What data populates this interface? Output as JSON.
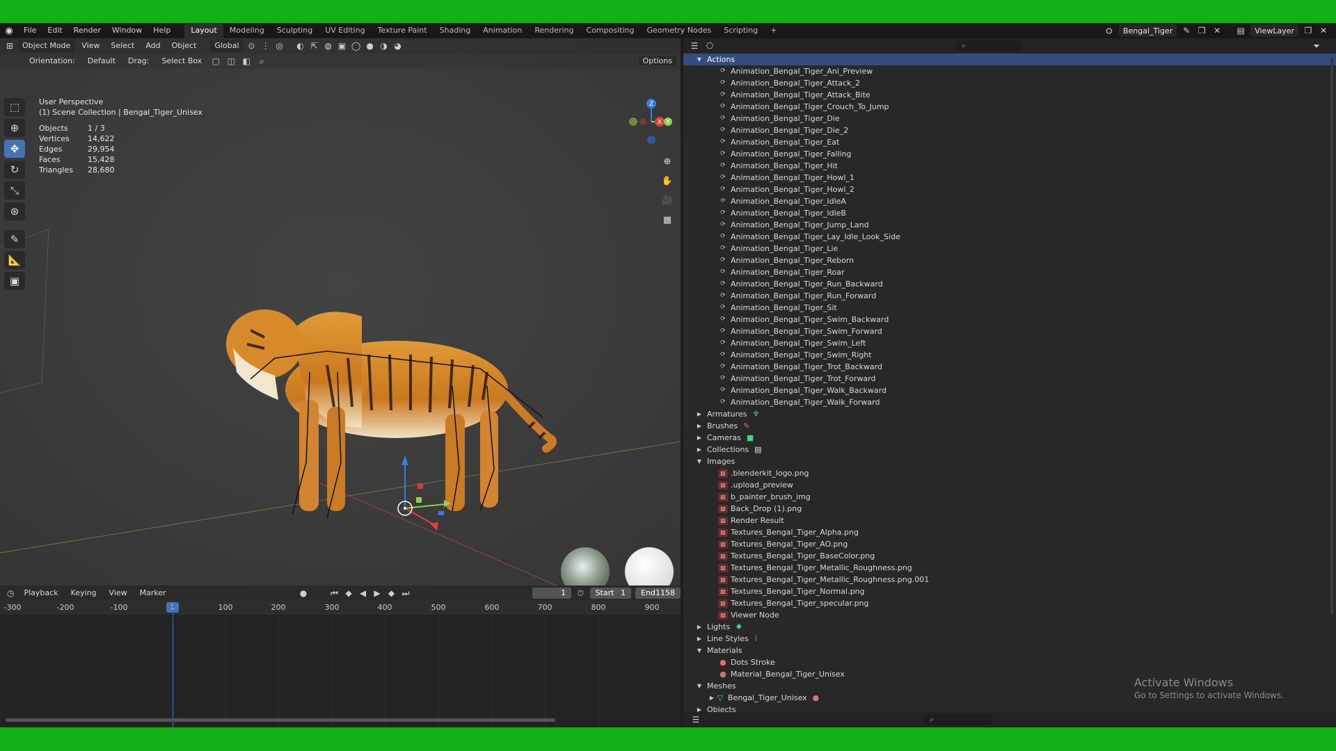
{
  "menu": [
    "File",
    "Edit",
    "Render",
    "Window",
    "Help"
  ],
  "workspaces": [
    "Layout",
    "Modeling",
    "Sculpting",
    "UV Editing",
    "Texture Paint",
    "Shading",
    "Animation",
    "Rendering",
    "Compositing",
    "Geometry Nodes",
    "Scripting"
  ],
  "active_workspace": "Layout",
  "add_workspace_label": "+",
  "scene_name": "Bengal_Tiger",
  "view_layer": "ViewLayer",
  "viewport": {
    "mode": "Object Mode",
    "menus": [
      "View",
      "Select",
      "Add",
      "Object"
    ],
    "orientation_global": "Global",
    "orientation_label": "Orientation:",
    "orientation_value": "Default",
    "drag_label": "Drag:",
    "drag_value": "Select Box",
    "options_label": "Options",
    "perspective": "User Perspective",
    "collection_path": "(1) Scene Collection | Bengal_Tiger_Unisex",
    "stats": [
      {
        "label": "Objects",
        "value": "1 / 3"
      },
      {
        "label": "Vertices",
        "value": "14,622"
      },
      {
        "label": "Edges",
        "value": "29,954"
      },
      {
        "label": "Faces",
        "value": "15,428"
      },
      {
        "label": "Triangles",
        "value": "28,680"
      }
    ],
    "gizmo_axes": [
      "Z",
      "X",
      "Y"
    ]
  },
  "timeline": {
    "menus": [
      "Playback",
      "Keying",
      "View",
      "Marker"
    ],
    "current_frame": "1",
    "start_label": "Start",
    "start_value": "1",
    "end_label": "End",
    "end_value": "1158",
    "ticks": [
      "-300",
      "-200",
      "-100",
      "100",
      "200",
      "300",
      "400",
      "500",
      "600",
      "700",
      "800",
      "900"
    ],
    "cursor_label": "1"
  },
  "outliner": {
    "rows": [
      {
        "type": "group",
        "label": "Actions",
        "expanded": true,
        "selected": true
      },
      {
        "type": "action",
        "label": "Animation_Bengal_Tiger_Ani_Preview"
      },
      {
        "type": "action",
        "label": "Animation_Bengal_Tiger_Attack_2"
      },
      {
        "type": "action",
        "label": "Animation_Bengal_Tiger_Attack_Bite"
      },
      {
        "type": "action",
        "label": "Animation_Bengal_Tiger_Crouch_To_Jump"
      },
      {
        "type": "action",
        "label": "Animation_Bengal_Tiger_Die"
      },
      {
        "type": "action",
        "label": "Animation_Bengal_Tiger_Die_2"
      },
      {
        "type": "action",
        "label": "Animation_Bengal_Tiger_Eat"
      },
      {
        "type": "action",
        "label": "Animation_Bengal_Tiger_Falling"
      },
      {
        "type": "action",
        "label": "Animation_Bengal_Tiger_Hit"
      },
      {
        "type": "action",
        "label": "Animation_Bengal_Tiger_Howl_1"
      },
      {
        "type": "action",
        "label": "Animation_Bengal_Tiger_Howl_2"
      },
      {
        "type": "action",
        "label": "Animation_Bengal_Tiger_IdleA"
      },
      {
        "type": "action",
        "label": "Animation_Bengal_Tiger_IdleB"
      },
      {
        "type": "action",
        "label": "Animation_Bengal_Tiger_Jump_Land"
      },
      {
        "type": "action",
        "label": "Animation_Bengal_Tiger_Lay_Idle_Look_Side"
      },
      {
        "type": "action",
        "label": "Animation_Bengal_Tiger_Lie"
      },
      {
        "type": "action",
        "label": "Animation_Bengal_Tiger_Reborn"
      },
      {
        "type": "action",
        "label": "Animation_Bengal_Tiger_Roar"
      },
      {
        "type": "action",
        "label": "Animation_Bengal_Tiger_Run_Backward"
      },
      {
        "type": "action",
        "label": "Animation_Bengal_Tiger_Run_Forward"
      },
      {
        "type": "action",
        "label": "Animation_Bengal_Tiger_Sit"
      },
      {
        "type": "action",
        "label": "Animation_Bengal_Tiger_Swim_Backward"
      },
      {
        "type": "action",
        "label": "Animation_Bengal_Tiger_Swim_Forward"
      },
      {
        "type": "action",
        "label": "Animation_Bengal_Tiger_Swim_Left"
      },
      {
        "type": "action",
        "label": "Animation_Bengal_Tiger_Swim_Right"
      },
      {
        "type": "action",
        "label": "Animation_Bengal_Tiger_Trot_Backward"
      },
      {
        "type": "action",
        "label": "Animation_Bengal_Tiger_Trot_Forward"
      },
      {
        "type": "action",
        "label": "Animation_Bengal_Tiger_Walk_Backward"
      },
      {
        "type": "action",
        "label": "Animation_Bengal_Tiger_Walk_Forward"
      },
      {
        "type": "group",
        "label": "Armatures",
        "expanded": false,
        "badge": "armature-icon",
        "badge_color": "#4fd08a"
      },
      {
        "type": "group",
        "label": "Brushes",
        "expanded": false,
        "badge": "brush-icon",
        "badge_color": "#e07070"
      },
      {
        "type": "group",
        "label": "Cameras",
        "expanded": false,
        "badge": "camera-icon",
        "badge_color": "#4fd08a"
      },
      {
        "type": "group",
        "label": "Collections",
        "expanded": false,
        "badge": "collection-icon",
        "badge_color": "#e8e8e8"
      },
      {
        "type": "group",
        "label": "Images",
        "expanded": true
      },
      {
        "type": "image",
        "label": ".blenderkit_logo.png"
      },
      {
        "type": "image",
        "label": ".upload_preview"
      },
      {
        "type": "image",
        "label": "b_painter_brush_img"
      },
      {
        "type": "image",
        "label": "Back_Drop (1).png"
      },
      {
        "type": "image",
        "label": "Render Result"
      },
      {
        "type": "image",
        "label": "Textures_Bengal_Tiger_Alpha.png"
      },
      {
        "type": "image",
        "label": "Textures_Bengal_Tiger_AO.png"
      },
      {
        "type": "image",
        "label": "Textures_Bengal_Tiger_BaseColor.png"
      },
      {
        "type": "image",
        "label": "Textures_Bengal_Tiger_Metallic_Roughness.png"
      },
      {
        "type": "image",
        "label": "Textures_Bengal_Tiger_Metallic_Roughness.png.001"
      },
      {
        "type": "image",
        "label": "Textures_Bengal_Tiger_Normal.png"
      },
      {
        "type": "image",
        "label": "Textures_Bengal_Tiger_specular.png"
      },
      {
        "type": "image",
        "label": "Viewer Node"
      },
      {
        "type": "group",
        "label": "Lights",
        "expanded": false,
        "badge": "light-icon",
        "badge_color": "#4fd08a"
      },
      {
        "type": "group",
        "label": "Line Styles",
        "expanded": false,
        "badge": "linestyle-icon",
        "badge_color": "#e07070"
      },
      {
        "type": "group",
        "label": "Materials",
        "expanded": true
      },
      {
        "type": "material",
        "label": "Dots Stroke"
      },
      {
        "type": "material",
        "label": "Material_Bengal_Tiger_Unisex"
      },
      {
        "type": "group",
        "label": "Meshes",
        "expanded": true
      },
      {
        "type": "mesh",
        "label": "Bengal_Tiger_Unisex",
        "badge": "material-icon",
        "badge_color": "#e07070"
      },
      {
        "type": "group",
        "label": "Objects",
        "expanded": false
      }
    ]
  },
  "watermark": {
    "title": "Activate Windows",
    "subtitle": "Go to Settings to activate Windows."
  },
  "colors": {
    "accent": "#4772b3",
    "selection": "#334d80",
    "green_screen": "#13b017"
  }
}
